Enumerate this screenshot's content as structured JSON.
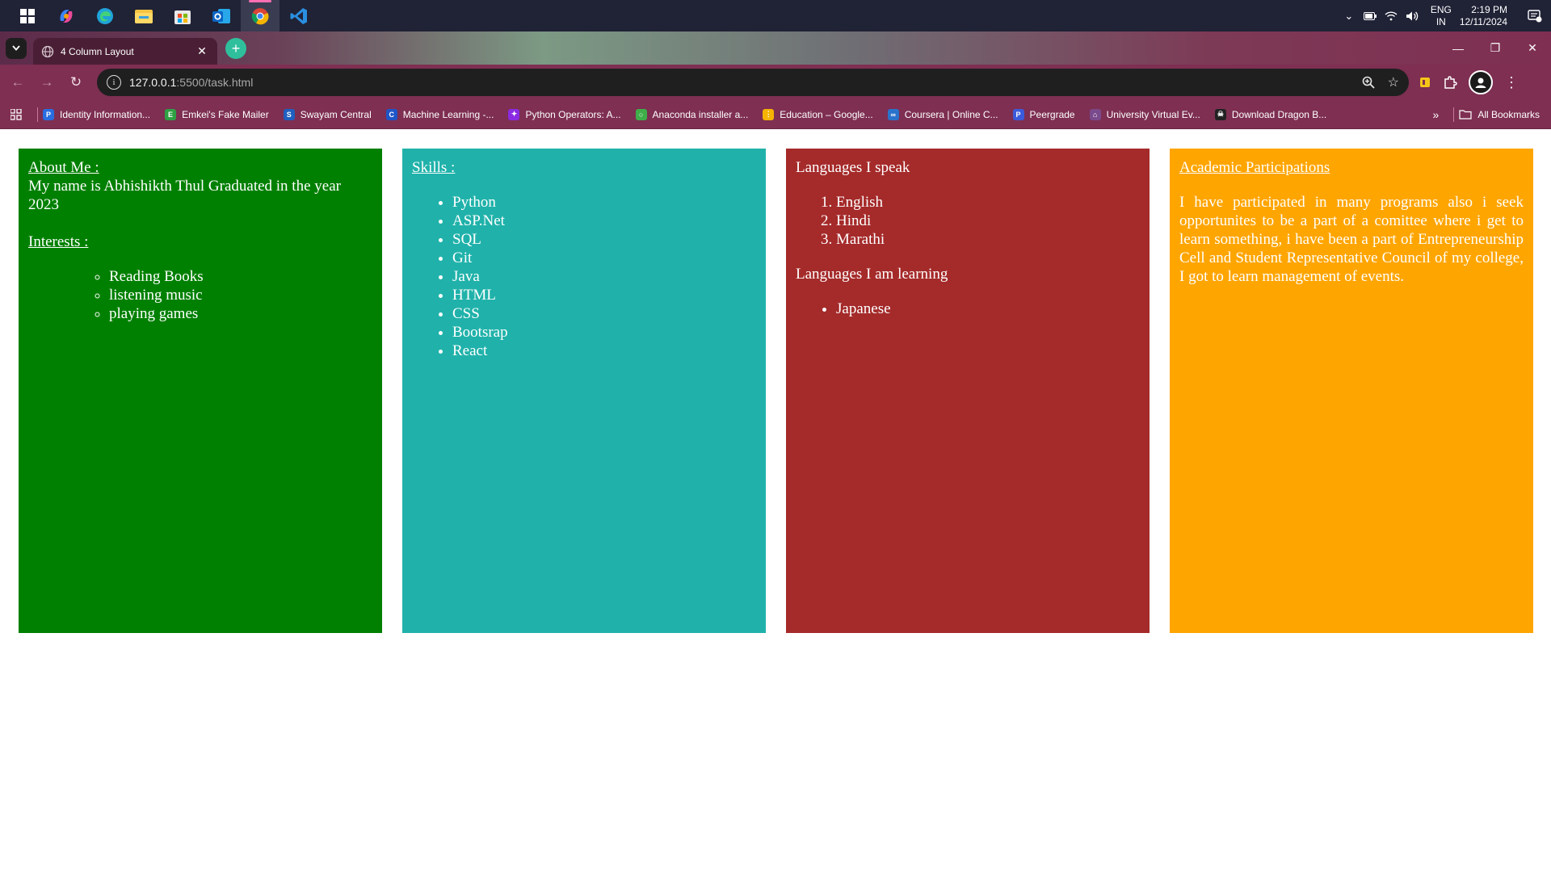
{
  "taskbar": {
    "apps": [
      "windows-start",
      "copilot",
      "edge",
      "file-explorer",
      "microsoft-store",
      "outlook",
      "chrome",
      "vs-code"
    ],
    "tray": {
      "lang_line1": "ENG",
      "lang_line2": "IN",
      "time": "2:19 PM",
      "date": "12/11/2024"
    }
  },
  "browser": {
    "tab": {
      "title": "4 Column Layout",
      "close": "✕"
    },
    "new_tab": "+",
    "window_controls": {
      "minimize": "—",
      "restore": "❐",
      "close": "✕"
    },
    "url": {
      "host": "127.0.0.1",
      "rest": ":5500/task.html"
    },
    "bookmarks": [
      {
        "label": "Identity Information...",
        "color": "#2a6de0",
        "glyph": "P"
      },
      {
        "label": "Emkei's Fake Mailer",
        "color": "#2ea043",
        "glyph": "E"
      },
      {
        "label": "Swayam Central",
        "color": "#1f5fbf",
        "glyph": "S"
      },
      {
        "label": "Machine Learning -...",
        "color": "#1e55c8",
        "glyph": "C"
      },
      {
        "label": "Python Operators: A...",
        "color": "#8a2be2",
        "glyph": "✦"
      },
      {
        "label": "Anaconda installer a...",
        "color": "#3fae49",
        "glyph": "○"
      },
      {
        "label": "Education – Google...",
        "color": "#f4b400",
        "glyph": "⋮"
      },
      {
        "label": "Coursera | Online C...",
        "color": "#2a73cc",
        "glyph": "∞"
      },
      {
        "label": "Peergrade",
        "color": "#3b5bdb",
        "glyph": "P"
      },
      {
        "label": "University Virtual Ev...",
        "color": "#7a4a8c",
        "glyph": "⌂"
      },
      {
        "label": "Download Dragon B...",
        "color": "#222222",
        "glyph": "☠"
      }
    ],
    "bookmarks_more": "»",
    "all_bookmarks": "All Bookmarks"
  },
  "content": {
    "col1": {
      "heading": "About Me :",
      "text": "My name is Abhishikth Thul Graduated in the year 2023",
      "interests_heading": "Interests :",
      "interests": [
        "Reading Books",
        "listening music",
        "playing games"
      ],
      "bg": "#008000"
    },
    "col2": {
      "heading": "Skills :",
      "skills": [
        "Python",
        "ASP.Net",
        "SQL",
        "Git",
        "Java",
        "HTML",
        "CSS",
        "Bootsrap",
        "React"
      ],
      "bg": "#20b2aa"
    },
    "col3": {
      "heading_speak": "Languages I speak",
      "speak": [
        "English",
        "Hindi",
        "Marathi"
      ],
      "heading_learning": "Languages I am learning",
      "learning": [
        "Japanese"
      ],
      "bg": "#a52a2a"
    },
    "col4": {
      "heading": "Academic Participations",
      "text": "I have participated in many programs also i seek opportunites to be a part of a comittee where i get to learn something, i have been a part of Entrepreneurship Cell and Student Representative Council of my college, I got to learn management of events.",
      "bg": "#ffa500"
    }
  }
}
